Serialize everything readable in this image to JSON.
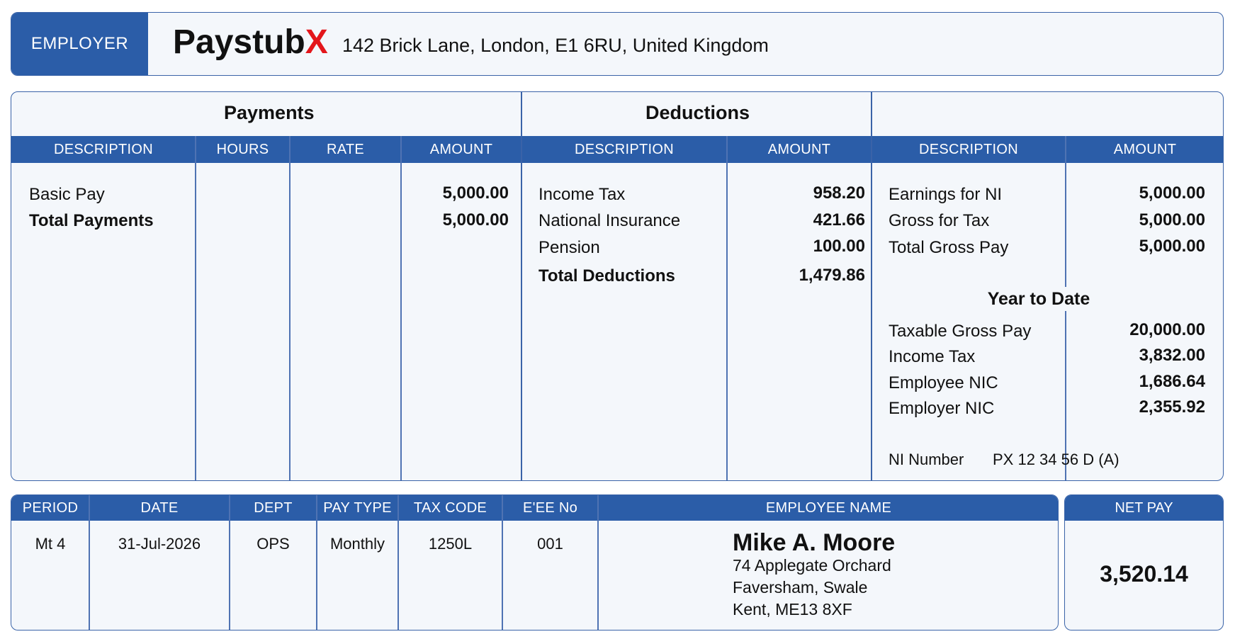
{
  "employer": {
    "label": "EMPLOYER",
    "brand_main": "Paystub",
    "brand_accent": "X",
    "address": "142 Brick Lane, London, E1 6RU, United Kingdom"
  },
  "payments": {
    "title": "Payments",
    "headers": [
      "DESCRIPTION",
      "HOURS",
      "RATE",
      "AMOUNT"
    ],
    "rows": [
      {
        "description": "Basic Pay",
        "amount": "5,000.00"
      },
      {
        "description": "Total Payments",
        "amount": "5,000.00"
      }
    ]
  },
  "deductions": {
    "title": "Deductions",
    "headers": [
      "DESCRIPTION",
      "AMOUNT"
    ],
    "rows": [
      {
        "description": "Income Tax",
        "amount": "958.20"
      },
      {
        "description": "National Insurance",
        "amount": "421.66"
      },
      {
        "description": "Pension",
        "amount": "100.00"
      },
      {
        "description": "Total Deductions",
        "amount": "1,479.86"
      }
    ]
  },
  "summary": {
    "headers": [
      "DESCRIPTION",
      "AMOUNT"
    ],
    "rows": [
      {
        "description": "Earnings for NI",
        "amount": "5,000.00"
      },
      {
        "description": "Gross for Tax",
        "amount": "5,000.00"
      },
      {
        "description": "Total Gross Pay",
        "amount": "5,000.00"
      }
    ],
    "ytd_title": "Year to Date",
    "ytd_rows": [
      {
        "description": "Taxable Gross Pay",
        "amount": "20,000.00"
      },
      {
        "description": "Income Tax",
        "amount": "3,832.00"
      },
      {
        "description": "Employee NIC",
        "amount": "1,686.64"
      },
      {
        "description": "Employer NIC",
        "amount": "2,355.92"
      }
    ],
    "ni_label": "NI Number",
    "ni_value": "PX 12 34 56 D (A)"
  },
  "employee": {
    "headers": {
      "period": "PERIOD",
      "date": "DATE",
      "dept": "DEPT",
      "pay_type": "PAY TYPE",
      "tax_code": "TAX CODE",
      "ee_no": "E'EE No",
      "name": "EMPLOYEE NAME"
    },
    "period": "Mt 4",
    "date": "31-Jul-2026",
    "dept": "OPS",
    "pay_type": "Monthly",
    "tax_code": "1250L",
    "ee_no": "001",
    "name": "Mike A. Moore",
    "address_line1": "74 Applegate Orchard",
    "address_line2": "Faversham, Swale",
    "address_line3": "Kent, ME13 8XF"
  },
  "net_pay": {
    "label": "NET PAY",
    "value": "3,520.14"
  },
  "colors": {
    "header_blue": "#2b5da8",
    "border_blue": "#3a63a8",
    "panel_bg": "#f4f7fb",
    "brand_accent": "#e3161b"
  }
}
